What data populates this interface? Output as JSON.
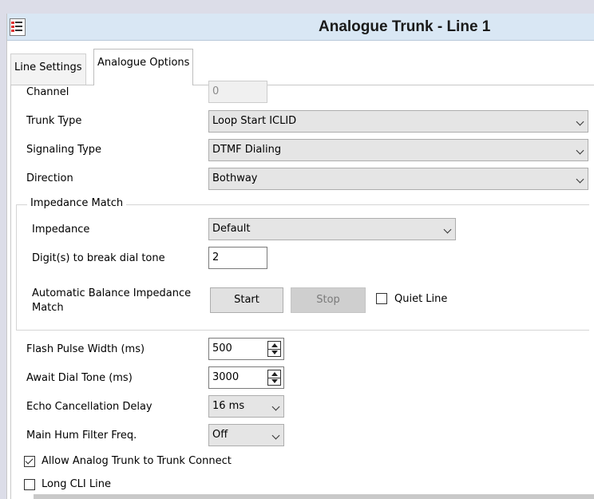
{
  "window": {
    "title": "Analogue Trunk - Line 1"
  },
  "tabs": [
    {
      "label": "Line Settings",
      "active": false
    },
    {
      "label": "Analogue Options",
      "active": true
    }
  ],
  "fields": {
    "channel": {
      "label": "Channel",
      "value": "0",
      "disabled": true
    },
    "trunk_type": {
      "label": "Trunk Type",
      "value": "Loop Start ICLID"
    },
    "signaling_type": {
      "label": "Signaling Type",
      "value": "DTMF Dialing"
    },
    "direction": {
      "label": "Direction",
      "value": "Bothway"
    }
  },
  "impedance_group": {
    "legend": "Impedance Match",
    "impedance": {
      "label": "Impedance",
      "value": "Default"
    },
    "digits_break": {
      "label": "Digit(s) to break dial tone",
      "value": "2"
    },
    "auto_balance": {
      "label_line1": "Automatic Balance Impedance",
      "label_line2": "Match",
      "start_label": "Start",
      "stop_label": "Stop",
      "quiet_line_label": "Quiet Line",
      "quiet_line_checked": false
    }
  },
  "flash_pulse": {
    "label": "Flash Pulse Width (ms)",
    "value": "500"
  },
  "await_dial": {
    "label": "Await Dial Tone (ms)",
    "value": "3000"
  },
  "echo_delay": {
    "label": "Echo Cancellation Delay",
    "value": "16 ms"
  },
  "hum_filter": {
    "label": "Main Hum Filter Freq.",
    "value": "Off"
  },
  "allow_connect": {
    "label": "Allow Analog Trunk to Trunk Connect",
    "checked": true
  },
  "long_cli": {
    "label": "Long CLI Line",
    "checked": false
  },
  "icons": {
    "app": "list-icon",
    "dropdown": "chevron-down-icon",
    "spinner": "spinner-icon"
  }
}
